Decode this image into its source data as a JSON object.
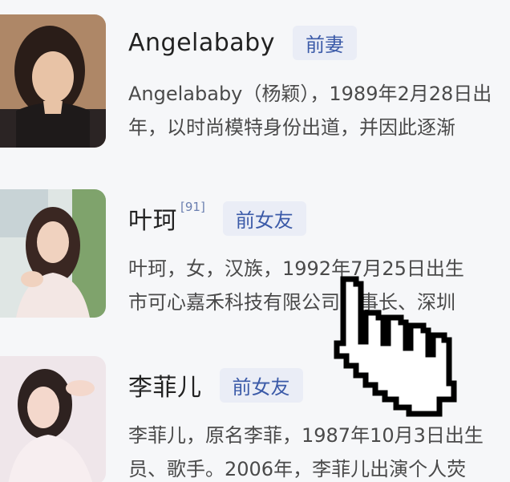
{
  "entries": [
    {
      "name": "Angelababy",
      "ref": "",
      "relation": "前妻",
      "desc_line1": "Angelababy（杨颖），1989年2月28日出",
      "desc_line2": "年，以时尚模特身份出道，并因此逐渐"
    },
    {
      "name": "叶珂",
      "ref": "[91]",
      "relation": "前女友",
      "desc_line1": "叶珂，女，汉族，1992年7月25日出生",
      "desc_line2": "市可心嘉禾科技有限公司董事长、深圳"
    },
    {
      "name": "李菲儿",
      "ref": "",
      "relation": "前女友",
      "desc_line1": "李菲儿，原名李菲，1987年10月3日出生",
      "desc_line2": "员、歌手。2006年，李菲儿出演个人荧"
    }
  ],
  "cursor": {
    "icon": "hand-pointer-icon"
  }
}
